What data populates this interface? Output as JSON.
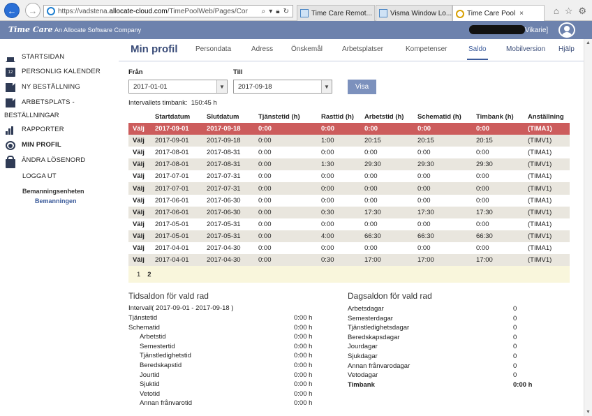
{
  "browser": {
    "url_prefix": "https://vadstena.",
    "url_domain": "allocate-cloud.com",
    "url_rest": "/TimePoolWeb/Pages/Cor",
    "tabs": [
      {
        "label": "Time Care Remot...",
        "active": false
      },
      {
        "label": "Visma Window Lo...",
        "active": false
      },
      {
        "label": "Time Care Pool",
        "active": true
      }
    ],
    "tab_close": "×"
  },
  "header": {
    "logo": "Time Care",
    "company": "An Allocate Software Company",
    "user_role": "Vikarie]"
  },
  "sidebar": {
    "items": [
      {
        "label": "STARTSIDAN"
      },
      {
        "label": "PERSONLIG KALENDER"
      },
      {
        "label": "NY BESTÄLLNING"
      },
      {
        "label": "ARBETSPLATS -"
      },
      {
        "label": "BESTÄLLNINGAR"
      },
      {
        "label": "RAPPORTER"
      },
      {
        "label": "MIN PROFIL"
      },
      {
        "label": "ÄNDRA LÖSENORD"
      },
      {
        "label": "LOGGA UT"
      }
    ],
    "unit_label": "Bemanningsenheten",
    "unit_value": "Bemanningen"
  },
  "page": {
    "title": "Min profil",
    "tabs": [
      "Persondata",
      "Adress",
      "Önskemål",
      "Arbetsplatser",
      "Kompetenser",
      "Saldo"
    ],
    "right_links": [
      "Mobilversion",
      "Hjälp"
    ]
  },
  "filters": {
    "from_label": "Från",
    "from_value": "2017-01-01",
    "to_label": "Till",
    "to_value": "2017-09-18",
    "show_button": "Visa",
    "bank_label": "Intervallets timbank:",
    "bank_value": "150:45 h"
  },
  "table": {
    "headers": [
      "",
      "Startdatum",
      "Slutdatum",
      "Tjänstetid (h)",
      "Rasttid (h)",
      "Arbetstid (h)",
      "Schematid (h)",
      "Timbank (h)",
      "Anställning"
    ],
    "rows": [
      [
        "Välj",
        "2017-09-01",
        "2017-09-18",
        "0:00",
        "0:00",
        "0:00",
        "0:00",
        "0:00",
        "(TIMA1)"
      ],
      [
        "Välj",
        "2017-09-01",
        "2017-09-18",
        "0:00",
        "1:00",
        "20:15",
        "20:15",
        "20:15",
        "(TIMV1)"
      ],
      [
        "Välj",
        "2017-08-01",
        "2017-08-31",
        "0:00",
        "0:00",
        "0:00",
        "0:00",
        "0:00",
        "(TIMA1)"
      ],
      [
        "Välj",
        "2017-08-01",
        "2017-08-31",
        "0:00",
        "1:30",
        "29:30",
        "29:30",
        "29:30",
        "(TIMV1)"
      ],
      [
        "Välj",
        "2017-07-01",
        "2017-07-31",
        "0:00",
        "0:00",
        "0:00",
        "0:00",
        "0:00",
        "(TIMA1)"
      ],
      [
        "Välj",
        "2017-07-01",
        "2017-07-31",
        "0:00",
        "0:00",
        "0:00",
        "0:00",
        "0:00",
        "(TIMV1)"
      ],
      [
        "Välj",
        "2017-06-01",
        "2017-06-30",
        "0:00",
        "0:00",
        "0:00",
        "0:00",
        "0:00",
        "(TIMA1)"
      ],
      [
        "Välj",
        "2017-06-01",
        "2017-06-30",
        "0:00",
        "0:30",
        "17:30",
        "17:30",
        "17:30",
        "(TIMV1)"
      ],
      [
        "Välj",
        "2017-05-01",
        "2017-05-31",
        "0:00",
        "0:00",
        "0:00",
        "0:00",
        "0:00",
        "(TIMA1)"
      ],
      [
        "Välj",
        "2017-05-01",
        "2017-05-31",
        "0:00",
        "4:00",
        "66:30",
        "66:30",
        "66:30",
        "(TIMV1)"
      ],
      [
        "Välj",
        "2017-04-01",
        "2017-04-30",
        "0:00",
        "0:00",
        "0:00",
        "0:00",
        "0:00",
        "(TIMA1)"
      ],
      [
        "Välj",
        "2017-04-01",
        "2017-04-30",
        "0:00",
        "0:30",
        "17:00",
        "17:00",
        "17:00",
        "(TIMV1)"
      ]
    ],
    "selected_row": 0,
    "pages": [
      "1",
      "2"
    ],
    "current_page": "2"
  },
  "tidsaldon": {
    "title": "Tidsaldon för vald rad",
    "interval": "Intervall( 2017-09-01 - 2017-09-18 )",
    "items": [
      {
        "label": "Tjänstetid",
        "value": "0:00 h",
        "indent": false
      },
      {
        "label": "Schematid",
        "value": "0:00 h",
        "indent": false
      },
      {
        "label": "Arbetstid",
        "value": "0:00 h",
        "indent": true
      },
      {
        "label": "Semestertid",
        "value": "0:00 h",
        "indent": true
      },
      {
        "label": "Tjänstledighetstid",
        "value": "0:00 h",
        "indent": true
      },
      {
        "label": "Beredskapstid",
        "value": "0:00 h",
        "indent": true
      },
      {
        "label": "Jourtid",
        "value": "0:00 h",
        "indent": true
      },
      {
        "label": "Sjuktid",
        "value": "0:00 h",
        "indent": true
      },
      {
        "label": "Vetotid",
        "value": "0:00 h",
        "indent": true
      },
      {
        "label": "Annan frånvarotid",
        "value": "0:00 h",
        "indent": true
      }
    ]
  },
  "dagsaldon": {
    "title": "Dagsaldon för vald rad",
    "items": [
      {
        "label": "Arbetsdagar",
        "value": "0"
      },
      {
        "label": "Semesterdagar",
        "value": "0"
      },
      {
        "label": "Tjänstledighetsdagar",
        "value": "0"
      },
      {
        "label": "Beredskapsdagar",
        "value": "0"
      },
      {
        "label": "Jourdagar",
        "value": "0"
      },
      {
        "label": "Sjukdagar",
        "value": "0"
      },
      {
        "label": "Annan frånvarodagar",
        "value": "0"
      },
      {
        "label": "Vetodagar",
        "value": "0"
      },
      {
        "label": "Timbank",
        "value": "0:00 h"
      }
    ]
  }
}
